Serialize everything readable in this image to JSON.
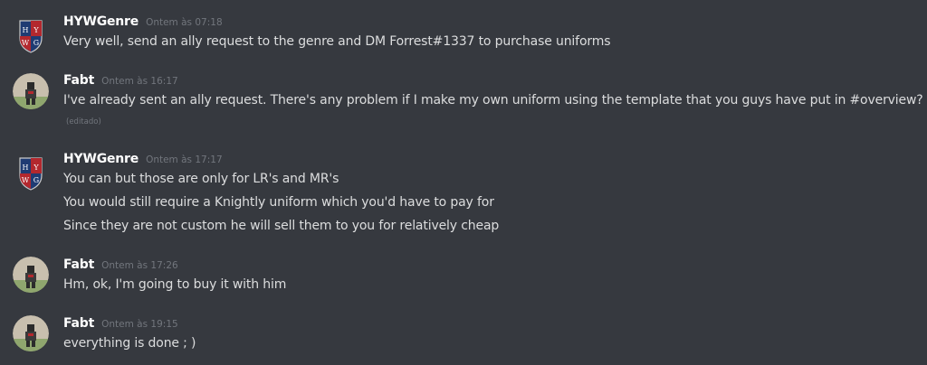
{
  "messages": [
    {
      "author": "HYWGenre",
      "timestamp": "Ontem às 07:18",
      "avatar": "crest-avatar",
      "lines": [
        "Very well, send an ally request to the genre and DM Forrest#1337 to purchase uniforms"
      ]
    },
    {
      "author": "Fabt",
      "timestamp": "Ontem às 16:17",
      "avatar": "knight-avatar",
      "lines": [
        "I've already sent an ally request. There's any problem if I make my own uniform using the template that you guys have put in #overview?"
      ],
      "edited": "(editado)"
    },
    {
      "author": "HYWGenre",
      "timestamp": "Ontem às 17:17",
      "avatar": "crest-avatar",
      "lines": [
        "You can but those are only for LR's and MR's",
        "You would still require a Knightly uniform which you'd have to pay for",
        "Since they are not custom he will sell them to you for relatively cheap"
      ]
    },
    {
      "author": "Fabt",
      "timestamp": "Ontem às 17:26",
      "avatar": "knight-avatar",
      "lines": [
        "Hm, ok, I'm going to buy it with him"
      ]
    },
    {
      "author": "Fabt",
      "timestamp": "Ontem às 19:15",
      "avatar": "knight-avatar",
      "lines": [
        "everything is done ; )"
      ]
    }
  ],
  "colors": {
    "background": "#36393f",
    "username": "#ffffff",
    "text": "#dcddde",
    "muted": "#72767d",
    "crest_blue": "#1f3b73",
    "crest_red": "#b3282e"
  }
}
